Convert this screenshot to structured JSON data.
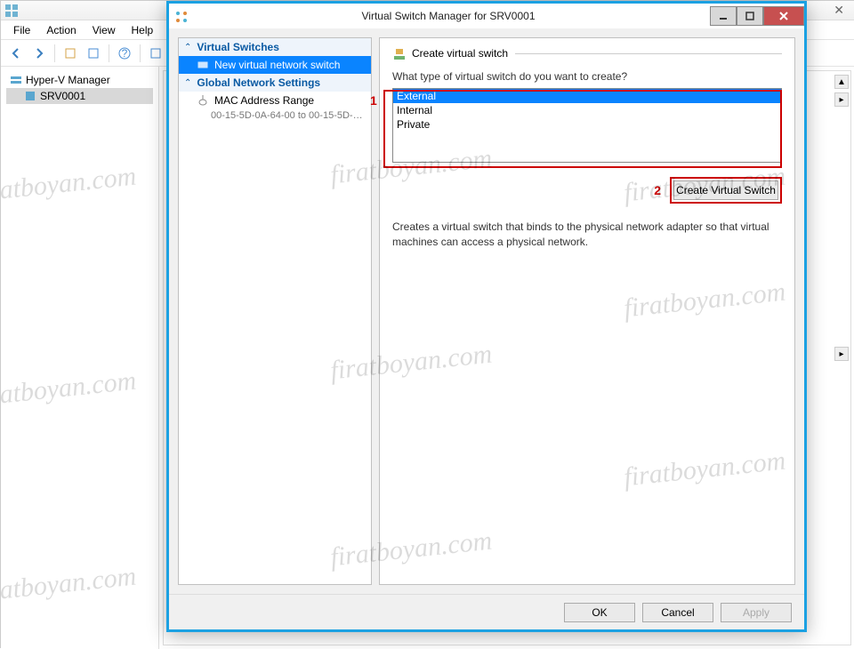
{
  "parent": {
    "menu": {
      "file": "File",
      "action": "Action",
      "view": "View",
      "help": "Help"
    },
    "tree": {
      "root": "Hyper-V Manager",
      "server": "SRV0001"
    }
  },
  "dialog": {
    "title": "Virtual Switch Manager for SRV0001",
    "left": {
      "cat1": "Virtual Switches",
      "item1": "New virtual network switch",
      "cat2": "Global Network Settings",
      "item2": "MAC Address Range",
      "item2_sub": "00-15-5D-0A-64-00 to 00-15-5D-0..."
    },
    "right": {
      "heading": "Create virtual switch",
      "prompt": "What type of virtual switch do you want to create?",
      "options": {
        "external": "External",
        "internal": "Internal",
        "private": "Private"
      },
      "create_btn": "Create Virtual Switch",
      "description": "Creates a virtual switch that binds to the physical network adapter so that virtual machines can access a physical network."
    },
    "footer": {
      "ok": "OK",
      "cancel": "Cancel",
      "apply": "Apply"
    }
  },
  "annotations": {
    "one": "1",
    "two": "2"
  },
  "watermark": "firatboyan.com"
}
